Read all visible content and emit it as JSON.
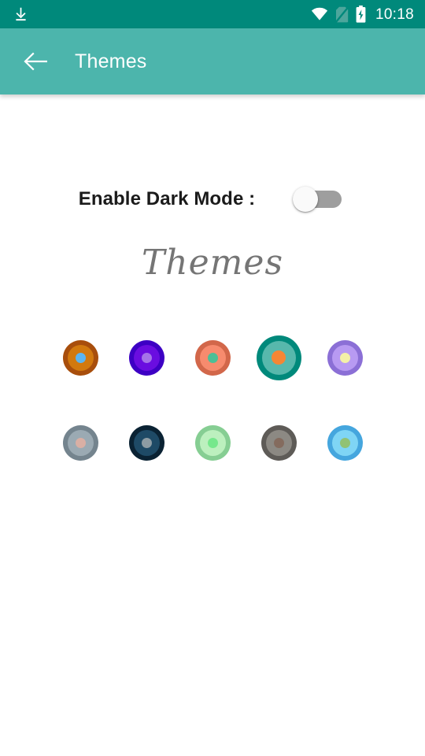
{
  "status_bar": {
    "background": "#00897B",
    "time": "10:18",
    "icons": [
      {
        "name": "download-icon",
        "position": "left"
      },
      {
        "name": "wifi-icon",
        "position": "right"
      },
      {
        "name": "no-sim-card-icon",
        "position": "right"
      },
      {
        "name": "battery-charging-icon",
        "position": "right"
      }
    ]
  },
  "app_bar": {
    "background": "#4CB5AC",
    "back_icon": "arrow-back-icon",
    "title": "Themes"
  },
  "settings": {
    "dark_mode_label": "Enable Dark Mode :",
    "dark_mode_enabled": false,
    "switch_track_color": "#9e9e9e",
    "switch_thumb_color": "#fafafa"
  },
  "themes_section": {
    "heading": "Themes",
    "heading_color": "#757575",
    "selected_index": 3,
    "swatches": [
      {
        "id": "theme-1",
        "ring": "#A84E0C",
        "fill": "#D2790E",
        "dot": "#5BB5F0",
        "selected": false
      },
      {
        "id": "theme-2",
        "ring": "#3D00C4",
        "fill": "#6A0DE0",
        "dot": "#A573E8",
        "selected": false
      },
      {
        "id": "theme-3",
        "ring": "#D2674A",
        "fill": "#F78B6E",
        "dot": "#4CBF96",
        "selected": false
      },
      {
        "id": "theme-4",
        "ring": "#00897B",
        "fill": "#57B8AC",
        "dot": "#F58634",
        "selected": true
      },
      {
        "id": "theme-5",
        "ring": "#8B6FD6",
        "fill": "#B89AF2",
        "dot": "#F4F0A8",
        "selected": false
      },
      {
        "id": "theme-6",
        "ring": "#74848E",
        "fill": "#9BAAB3",
        "dot": "#D9AFA4",
        "selected": false
      },
      {
        "id": "theme-7",
        "ring": "#0A2233",
        "fill": "#1E4A66",
        "dot": "#8C9BA3",
        "selected": false
      },
      {
        "id": "theme-8",
        "ring": "#86CE93",
        "fill": "#BCF0BE",
        "dot": "#76E88C",
        "selected": false
      },
      {
        "id": "theme-9",
        "ring": "#5E5B57",
        "fill": "#8C8983",
        "dot": "#846B5E",
        "selected": false
      },
      {
        "id": "theme-10",
        "ring": "#45A6DE",
        "fill": "#7FD5F5",
        "dot": "#91C274",
        "selected": false
      }
    ]
  }
}
